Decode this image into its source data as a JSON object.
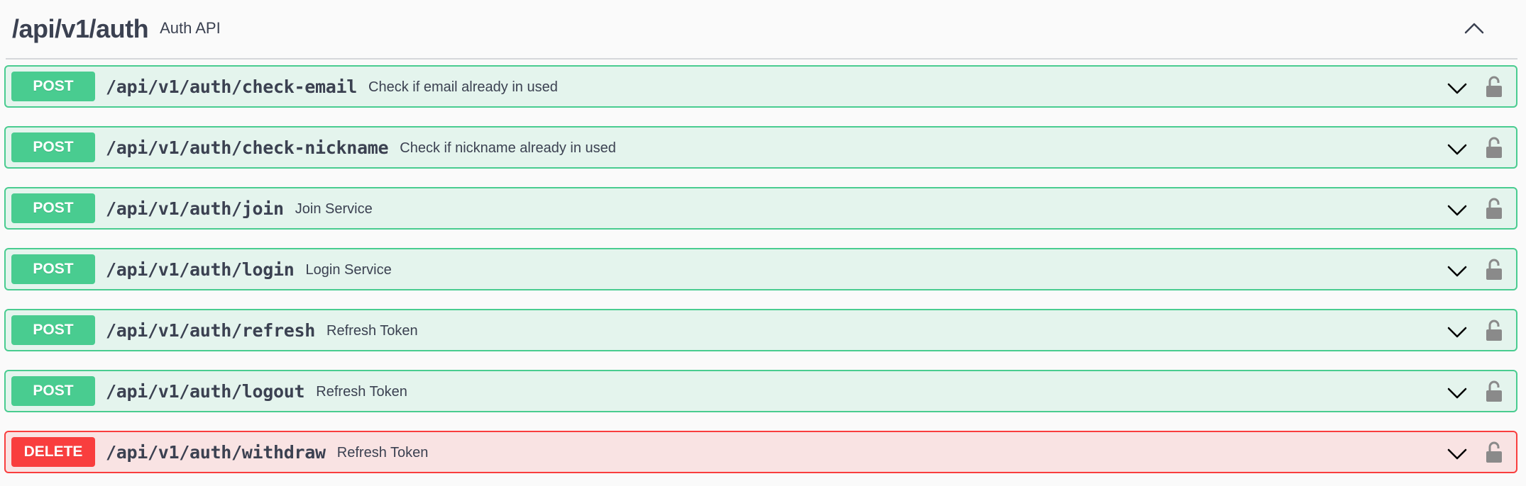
{
  "section": {
    "title": "/api/v1/auth",
    "description": "Auth API",
    "collapse_icon": "chevron-up-icon"
  },
  "operations": [
    {
      "method": "POST",
      "path": "/api/v1/auth/check-email",
      "summary": "Check if email already in used"
    },
    {
      "method": "POST",
      "path": "/api/v1/auth/check-nickname",
      "summary": "Check if nickname already in used"
    },
    {
      "method": "POST",
      "path": "/api/v1/auth/join",
      "summary": "Join Service"
    },
    {
      "method": "POST",
      "path": "/api/v1/auth/login",
      "summary": "Login Service"
    },
    {
      "method": "POST",
      "path": "/api/v1/auth/refresh",
      "summary": "Refresh Token"
    },
    {
      "method": "POST",
      "path": "/api/v1/auth/logout",
      "summary": "Refresh Token"
    },
    {
      "method": "DELETE",
      "path": "/api/v1/auth/withdraw",
      "summary": "Refresh Token"
    }
  ],
  "colors": {
    "post": "#49cc90",
    "delete": "#f93e3e",
    "text": "#3b4151"
  }
}
